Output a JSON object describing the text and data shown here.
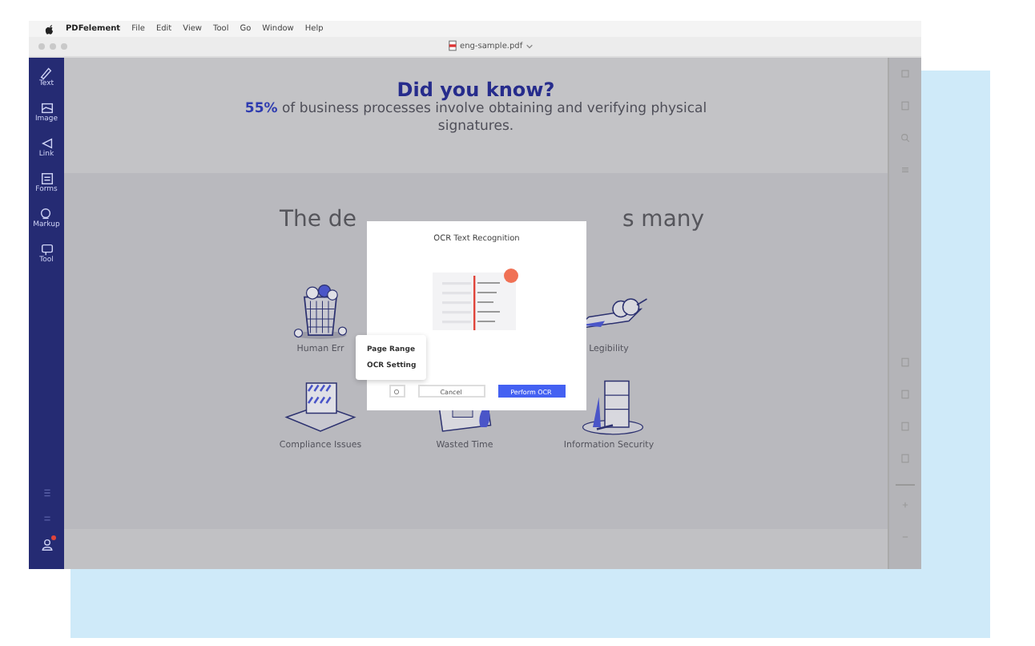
{
  "menu_bar": {
    "app_name": "PDFelement",
    "items": [
      "File",
      "Edit",
      "View",
      "Tool",
      "Go",
      "Window",
      "Help"
    ]
  },
  "title_bar": {
    "file_name": "eng-sample.pdf"
  },
  "sidebar": {
    "items": [
      {
        "kind": "text",
        "label": "Text"
      },
      {
        "kind": "image",
        "label": "Image"
      },
      {
        "kind": "link",
        "label": "Link"
      },
      {
        "kind": "forms",
        "label": "Forms"
      },
      {
        "kind": "markup",
        "label": "Markup"
      },
      {
        "kind": "tool",
        "label": "Tool"
      }
    ],
    "account_badge": true
  },
  "page": {
    "heading": "Did you know?",
    "paragraph": "**55%** of business processes involve obtaining and verifying physical signatures.",
    "section_title_left": "The de",
    "section_title_right": "s many",
    "illustrations": [
      {
        "kind": "trash",
        "label": "Human Err"
      },
      {
        "kind": "scroll",
        "label": "Legibility"
      },
      {
        "kind": "stamp",
        "label": "Compliance Issues"
      },
      {
        "kind": "calendar",
        "label": "Wasted Time"
      },
      {
        "kind": "cabinet",
        "label": "Information Security"
      }
    ]
  },
  "dialog": {
    "title": "OCR Text Recognition",
    "buttons": [
      "Cancel",
      "Perform OCR"
    ]
  },
  "popover_menu": {
    "items": [
      "Page Range",
      "OCR Setting"
    ]
  }
}
